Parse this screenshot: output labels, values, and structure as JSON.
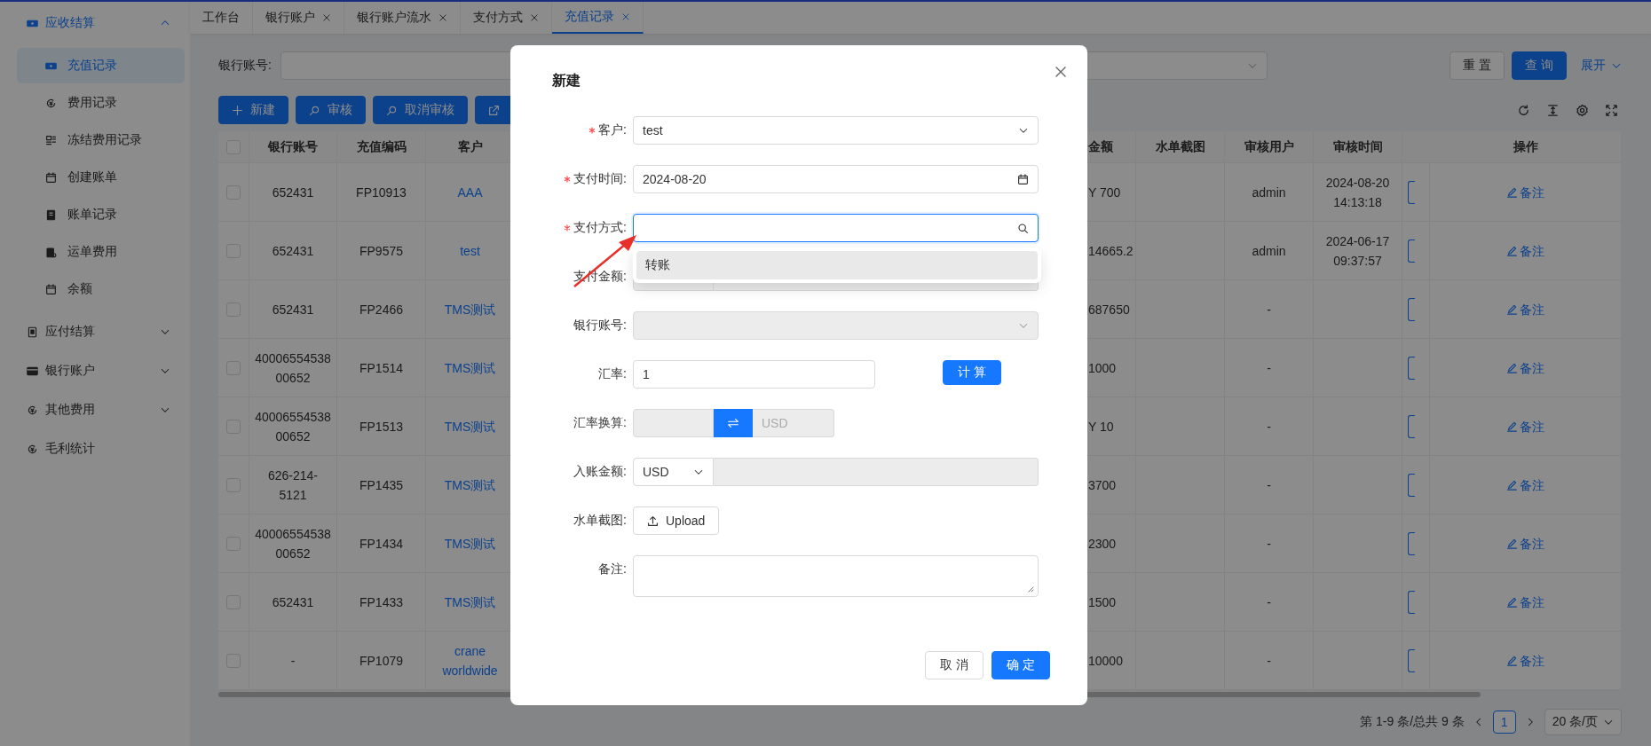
{
  "tabs": [
    {
      "label": "工作台",
      "selected": false,
      "closable": false
    },
    {
      "label": "银行账户",
      "selected": false,
      "closable": true
    },
    {
      "label": "银行账户流水",
      "selected": false,
      "closable": true
    },
    {
      "label": "支付方式",
      "selected": false,
      "closable": true
    },
    {
      "label": "充值记录",
      "selected": true,
      "closable": true
    }
  ],
  "sidebar": {
    "items": [
      {
        "label": "应收结算",
        "kind": "group",
        "active": true,
        "expanded": true,
        "children": [
          {
            "label": "充值记录",
            "selected": true
          },
          {
            "label": "费用记录",
            "selected": false
          },
          {
            "label": "冻结费用记录",
            "selected": false
          },
          {
            "label": "创建账单",
            "selected": false
          },
          {
            "label": "账单记录",
            "selected": false
          },
          {
            "label": "运单费用",
            "selected": false
          },
          {
            "label": "余额",
            "selected": false
          }
        ]
      },
      {
        "label": "应付结算",
        "kind": "group",
        "active": false,
        "expanded": false
      },
      {
        "label": "银行账户",
        "kind": "group",
        "active": false,
        "expanded": false
      },
      {
        "label": "其他费用",
        "kind": "group",
        "active": false,
        "expanded": false
      },
      {
        "label": "毛利统计",
        "kind": "link",
        "active": false
      }
    ]
  },
  "filter": {
    "label": "银行账号:",
    "buttons": [
      {
        "label": "重 置",
        "primary": false
      },
      {
        "label": "查 询",
        "primary": true
      }
    ],
    "expand": "展开"
  },
  "toolbar": {
    "buttons": [
      {
        "label": "新建"
      },
      {
        "label": "审核"
      },
      {
        "label": "取消审核"
      }
    ]
  },
  "table": {
    "all_checked": false,
    "columns": [
      "银行账号",
      "充值编码",
      "客户",
      "金额",
      "水单截图",
      "审核用户",
      "审核时间",
      "操作"
    ],
    "rows": [
      {
        "checked": false,
        "bank_account": "652431",
        "code": "FP10913",
        "customer": "AAA",
        "amount": "Y 700",
        "reviewer": "admin",
        "review_time": "2024-08-20 14:13:18",
        "action": "备注"
      },
      {
        "checked": false,
        "bank_account": "652431",
        "code": "FP9575",
        "customer": "test",
        "amount": "14665.2",
        "reviewer": "admin",
        "review_time": "2024-06-17 09:37:57",
        "action": "备注"
      },
      {
        "checked": false,
        "bank_account": "652431",
        "code": "FP2466",
        "customer": "TMS测试",
        "amount": "687650",
        "reviewer": "-",
        "action": "备注"
      },
      {
        "checked": false,
        "bank_account": "4000655453800652",
        "code": "FP1514",
        "customer": "TMS测试",
        "amount": "1000",
        "reviewer": "-",
        "action": "备注"
      },
      {
        "checked": false,
        "bank_account": "4000655453800652",
        "code": "FP1513",
        "customer": "TMS测试",
        "amount": "Y 10",
        "reviewer": "-",
        "action": "备注"
      },
      {
        "checked": false,
        "bank_account": "626-214-5121",
        "code": "FP1435",
        "customer": "TMS测试",
        "amount": "3700",
        "reviewer": "-",
        "action": "备注"
      },
      {
        "checked": false,
        "bank_account": "4000655453800652",
        "code": "FP1434",
        "customer": "TMS测试",
        "amount": "2300",
        "reviewer": "-",
        "action": "备注"
      },
      {
        "checked": false,
        "bank_account": "652431",
        "code": "FP1433",
        "customer": "TMS测试",
        "amount": "1500",
        "reviewer": "-",
        "action": "备注"
      },
      {
        "checked": false,
        "bank_account": "-",
        "code": "FP1079",
        "customer": "crane worldwide",
        "amount": "10000",
        "reviewer": "-",
        "action": "备注"
      }
    ]
  },
  "pagination": {
    "total": "第 1-9 条/总共 9 条",
    "pages": [
      {
        "label": "1",
        "selected": true
      }
    ],
    "page_size": "20 条/页"
  },
  "dialog": {
    "title": "新建",
    "fields": [
      {
        "label": "客户:",
        "kind": "select",
        "required": true,
        "disabled": false,
        "value": "test"
      },
      {
        "label": "支付时间:",
        "kind": "date",
        "required": true,
        "disabled": false,
        "value": "2024-08-20"
      },
      {
        "label": "支付方式:",
        "kind": "search",
        "required": true,
        "disabled": false,
        "focused": true,
        "options": [
          {
            "label": "转账",
            "highlighted": true
          }
        ]
      },
      {
        "label": "支付金额:",
        "kind": "amount",
        "required": false,
        "disabled": true
      },
      {
        "label": "银行账号:",
        "kind": "select",
        "required": false,
        "disabled": true
      },
      {
        "label": "汇率:",
        "kind": "text_button",
        "required": false,
        "disabled": false,
        "value": "1",
        "button": "计 算"
      },
      {
        "label": "汇率换算:",
        "kind": "convert",
        "required": false,
        "disabled": true,
        "target": "USD"
      },
      {
        "label": "入账金额:",
        "kind": "currency",
        "required": false,
        "disabled": true,
        "value": "USD"
      },
      {
        "label": "水单截图:",
        "kind": "upload",
        "required": false,
        "disabled": false,
        "button": "Upload"
      },
      {
        "label": "备注:",
        "kind": "textarea",
        "required": false,
        "disabled": false
      }
    ],
    "buttons": [
      {
        "label": "取 消",
        "primary": false
      },
      {
        "label": "确 定",
        "primary": true
      }
    ]
  }
}
